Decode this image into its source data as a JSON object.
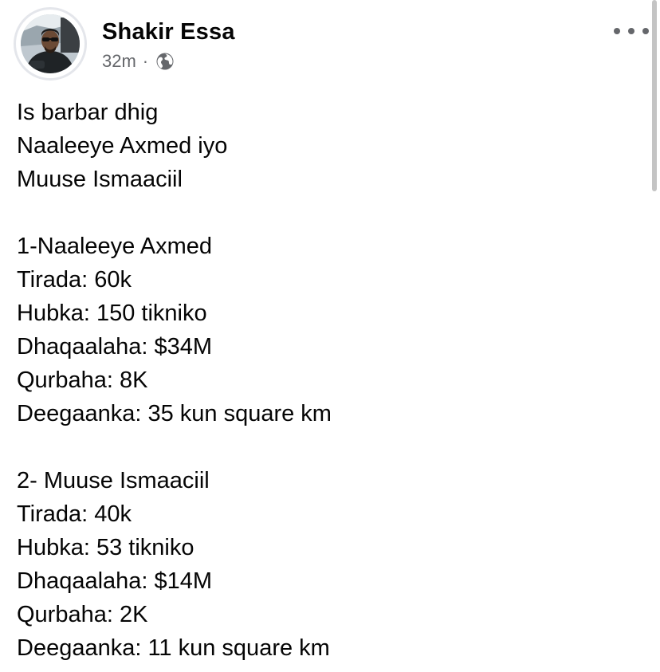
{
  "author": {
    "name": "Shakir Essa",
    "avatar_icon": "profile-photo"
  },
  "meta": {
    "timestamp": "32m",
    "separator": "·",
    "audience_icon": "globe-icon"
  },
  "post": {
    "intro": [
      "Is barbar dhig",
      "Naaleeye Axmed iyo",
      "Muuse Ismaaciil"
    ],
    "section1": [
      "1-Naaleeye Axmed",
      "Tirada: 60k",
      "Hubka: 150 tikniko",
      "Dhaqaalaha: $34M",
      "Qurbaha: 8K",
      "Deegaanka: 35 kun square km"
    ],
    "section2": [
      "2- Muuse Ismaaciil",
      "Tirada: 40k",
      "Hubka: 53 tikniko",
      "Dhaqaalaha: $14M",
      "Qurbaha: 2K",
      "Deegaanka: 11 kun square km"
    ]
  },
  "menu": {
    "more_icon": "more-options-icon"
  },
  "colors": {
    "text": "#050505",
    "secondary_text": "#65676b",
    "avatar_ring": "#e4e6eb"
  }
}
